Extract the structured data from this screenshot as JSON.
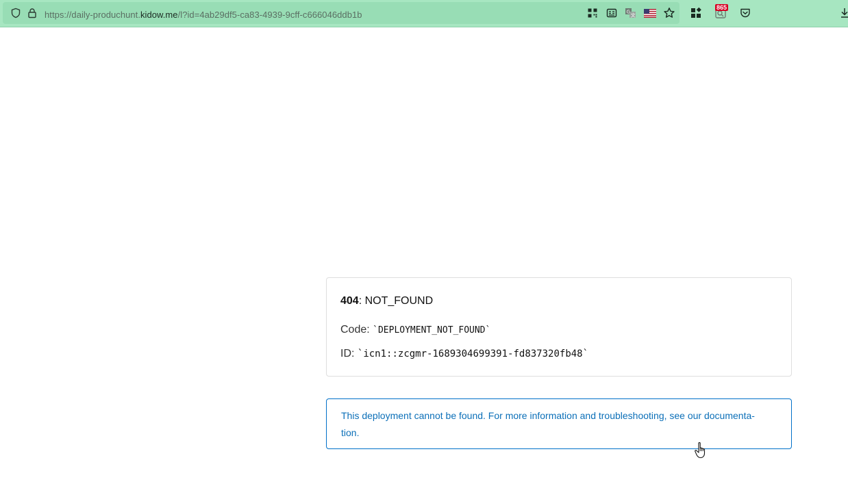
{
  "browser": {
    "url_prefix": "https://daily-produchunt.",
    "url_host": "kidow.me",
    "url_suffix": "/l?id=4ab29df5-ca83-4939-9cff-c666046ddb1b",
    "notification_count": "865",
    "icons": [
      "shield-icon",
      "lock-icon",
      "qr-code-icon",
      "reader-view-icon",
      "translate-icon",
      "us-flag-icon",
      "bookmark-star-icon",
      "extensions-grid-icon",
      "notifications-icon",
      "pocket-icon",
      "download-icon"
    ],
    "toolbar_color": "#a7e6c1"
  },
  "error": {
    "code_number": "404",
    "status": ": NOT_FOUND",
    "code_label": "Code: ",
    "code_value": "`DEPLOYMENT_NOT_FOUND`",
    "id_label": "ID: ",
    "id_value": "`icn1::zcgmr-1689304699391-fd837320fb48`"
  },
  "info": {
    "line1": "This deployment cannot be found. For more information and troubleshooting, see our documenta-",
    "line2": "tion.",
    "color": "#0b6fb8"
  }
}
